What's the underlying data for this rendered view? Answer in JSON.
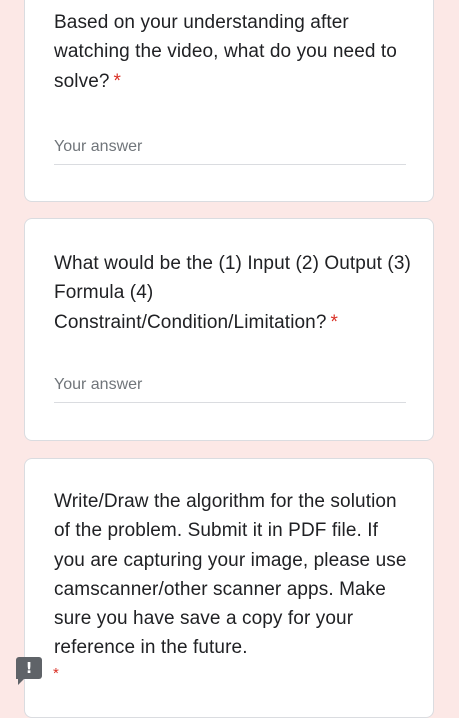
{
  "questions": [
    {
      "text": "Based on your understanding after watching the video, what do you need to solve?",
      "required_mark": "*",
      "answer_placeholder": "Your answer"
    },
    {
      "text": "What would be the (1) Input (2) Output (3) Formula (4) Constraint/Condition/Limitation?",
      "required_mark": "*",
      "answer_placeholder": "Your answer"
    },
    {
      "text": "Write/Draw the algorithm for the solution of the problem. Submit it in PDF file. If you are capturing your image, please use camscanner/other scanner apps. Make sure you have save a copy for your reference in the future.",
      "required_mark": "*"
    }
  ],
  "feedback": {
    "icon": "report-problem-icon",
    "glyph": "!"
  },
  "colors": {
    "page_background": "#fce8e6",
    "card_background": "#ffffff",
    "required": "#d93025",
    "placeholder": "#70757a"
  }
}
